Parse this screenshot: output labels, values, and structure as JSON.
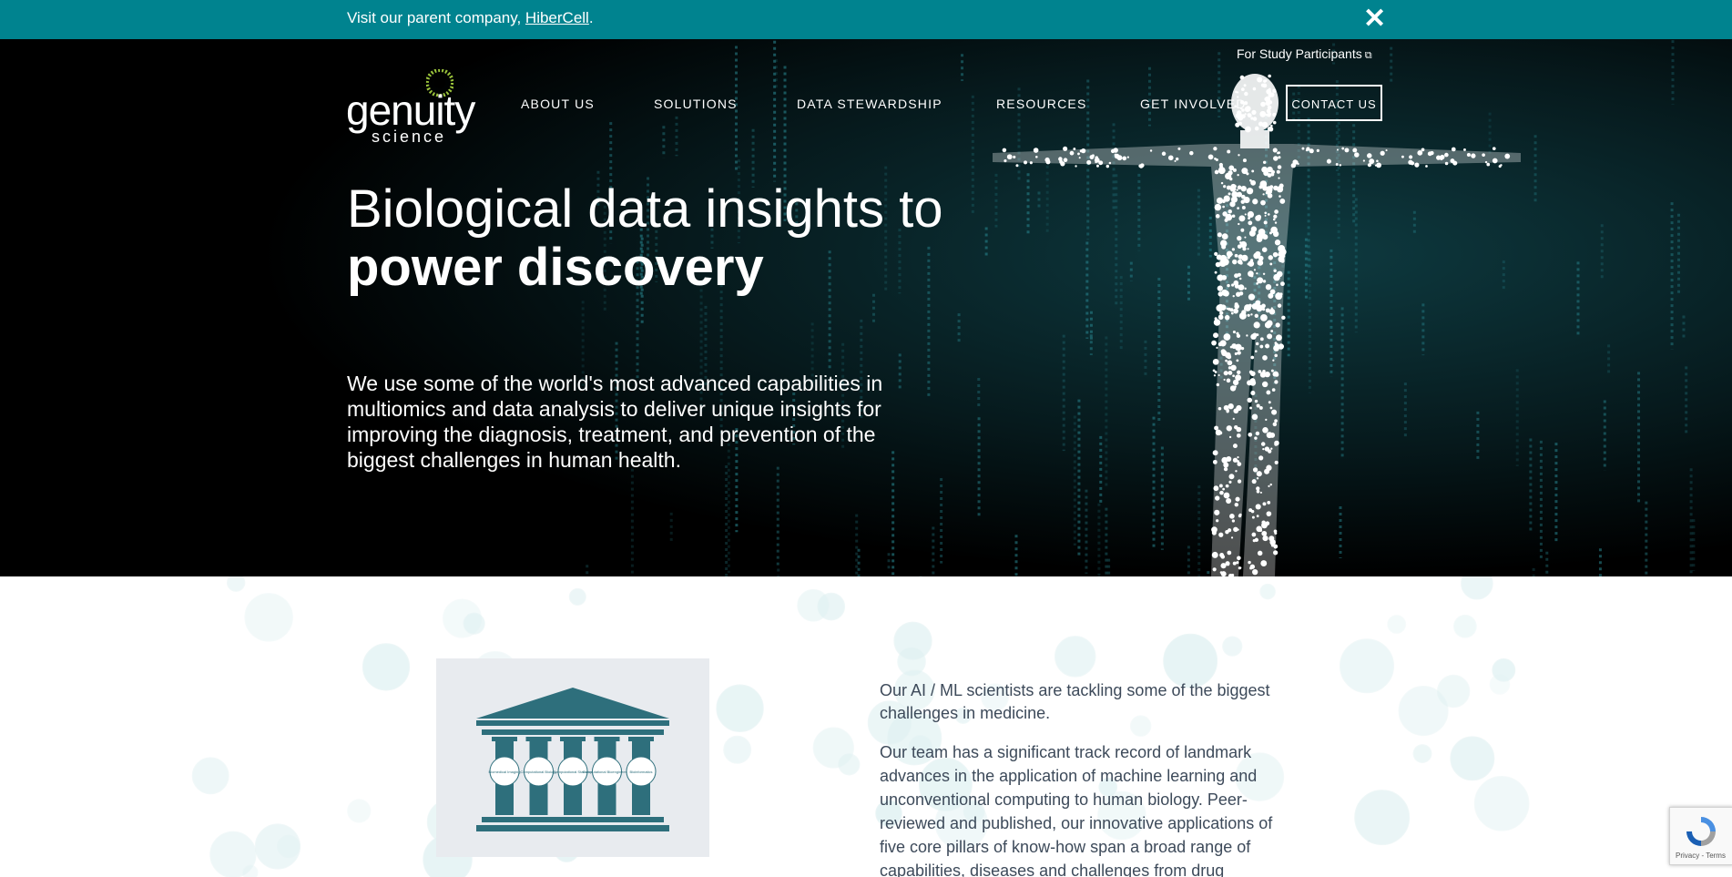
{
  "topbar": {
    "message_prefix": "Visit our parent company, ",
    "link": "HiberCell",
    "suffix": ".",
    "close_icon": "close-icon"
  },
  "header": {
    "participants_link": "For Study Participants",
    "logo_word": "genuity",
    "logo_sub": "science",
    "nav": [
      "ABOUT US",
      "SOLUTIONS",
      "DATA STEWARDSHIP",
      "RESOURCES",
      "GET INVOLVED"
    ],
    "contact": "CONTACT US"
  },
  "hero": {
    "headline_line1": "Biological data insights to",
    "headline_line2": "power discovery",
    "intro": "We use some of the world's most advanced capabilities in multiomics and data analysis to deliver unique insights for improving the diagnosis, treatment, and prevention of the biggest challenges in human health."
  },
  "section": {
    "pillars": [
      "Biomedical Imaging",
      "Computational Biology",
      "Computational Statistics",
      "Computational Bioengineering",
      "Bioinformatics"
    ],
    "text1": "Our AI / ML scientists are tackling some of the biggest challenges in medicine.",
    "text2": "Our team has a significant track record of landmark advances in the application of machine learning and unconventional computing to human biology. Peer-reviewed and published, our innovative applications of five core pillars of know-how span a broad range of capabilities, diseases and challenges from drug"
  },
  "recaptcha": {
    "terms": "Privacy - Terms"
  },
  "colors": {
    "topbar": "#00838f",
    "pillar": "#2e6f7c",
    "text": "#3d4a5a"
  }
}
